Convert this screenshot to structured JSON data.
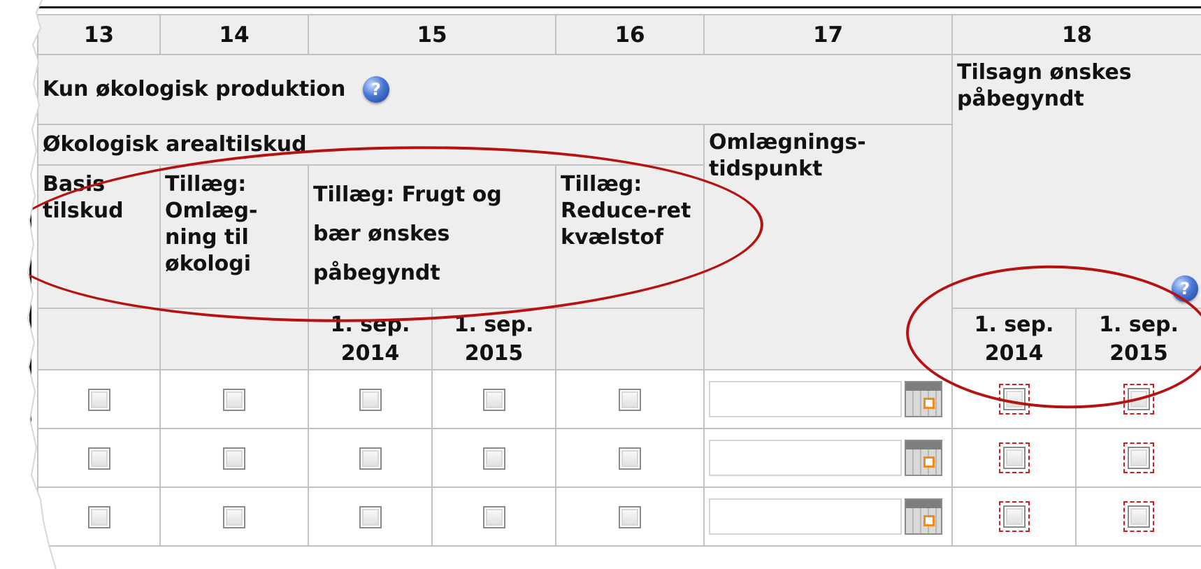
{
  "columns": {
    "c13": "13",
    "c14": "14",
    "c15": "15",
    "c16": "16",
    "c17": "17",
    "c18": "18"
  },
  "headers": {
    "organic_only": "Kun økologisk produktion",
    "commitment_start": "Tilsagn ønskes påbegyndt",
    "organic_area_grant": "Økologisk arealtilskud",
    "conversion_time": "Omlægnings-tidspunkt",
    "basic_grant": "Basis tilskud",
    "supplement_conversion": "Tillæg: Omlæg-ning til økologi",
    "supplement_fruit": "Tillæg: Frugt og bær ønskes påbegyndt",
    "supplement_nitrogen": "Tillæg: Reduce-ret kvælstof"
  },
  "dates": {
    "fruit_2014": "1. sep. 2014",
    "fruit_2015": "1. sep. 2015",
    "commit_2014": "1. sep. 2014",
    "commit_2015": "1. sep. 2015"
  },
  "help_icon_symbol": "?",
  "rows": [
    {
      "conversion_date_value": ""
    },
    {
      "conversion_date_value": ""
    },
    {
      "conversion_date_value": ""
    }
  ],
  "colors": {
    "annotation_red": "#b51212",
    "header_bg": "#eeeeee",
    "border": "#c2c2c2",
    "flag_dashed": "#d11c1c"
  },
  "icons": {
    "help": "help-icon",
    "calendar": "calendar-icon",
    "checkbox": "checkbox"
  }
}
